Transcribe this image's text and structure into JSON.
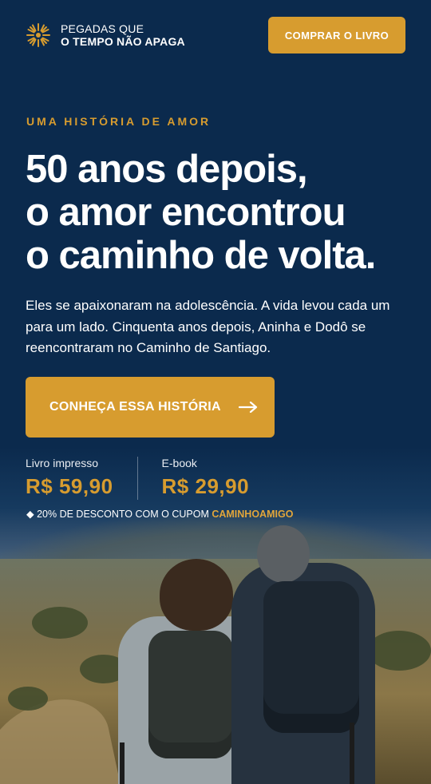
{
  "brand": {
    "line1": "PEGADAS QUE",
    "line2": "O TEMPO NÃO APAGA",
    "icon": "sun-icon",
    "accent": "#d79c2f"
  },
  "header": {
    "buy_label": "COMPRAR O LIVRO"
  },
  "hero": {
    "eyebrow": "UMA HISTÓRIA DE AMOR",
    "headline": [
      "50 anos depois,",
      "o amor encontrou",
      "o caminho de volta."
    ],
    "description": "Eles se apaixonaram na adolescência. A vida levou cada um para um lado. Cinquenta anos depois, Aninha e Dodô se reencontraram no Caminho de Santiago.",
    "cta_label": "CONHEÇA ESSA HISTÓRIA",
    "cta_icon": "arrow-right-icon"
  },
  "prices": [
    {
      "label": "Livro impresso",
      "value": "R$ 59,90"
    },
    {
      "label": "E-book",
      "value": "R$ 29,90"
    }
  ],
  "coupon": {
    "prefix": "◆ 20% DE DESCONTO COM O CUPOM ",
    "code": "CAMINHOAMIGO"
  }
}
